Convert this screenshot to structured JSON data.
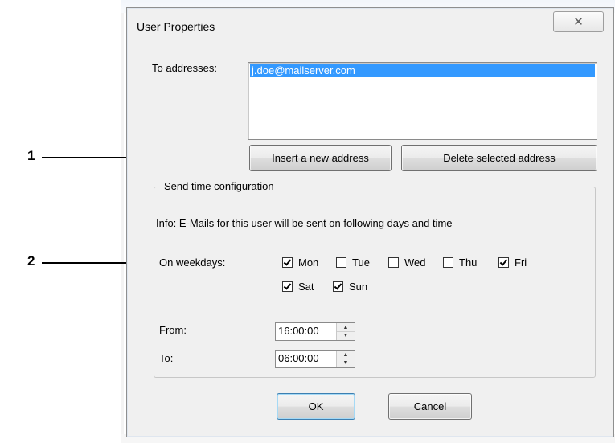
{
  "dialog": {
    "title": "User Properties",
    "close_glyph": "✕"
  },
  "addresses": {
    "label": "To addresses:",
    "items": [
      "j.doe@mailserver.com"
    ],
    "insert_button": "Insert a new address",
    "delete_button": "Delete selected address"
  },
  "send_time": {
    "group_title": "Send time configuration",
    "info": "Info: E-Mails for this user will be sent on following days and time",
    "weekdays_label": "On weekdays:",
    "days": [
      {
        "label": "Mon",
        "checked": true
      },
      {
        "label": "Tue",
        "checked": false
      },
      {
        "label": "Wed",
        "checked": false
      },
      {
        "label": "Thu",
        "checked": false
      },
      {
        "label": "Fri",
        "checked": true
      },
      {
        "label": "Sat",
        "checked": true
      },
      {
        "label": "Sun",
        "checked": true
      }
    ],
    "from_label": "From:",
    "from_value": "16:00:00",
    "to_label": "To:",
    "to_value": "06:00:00"
  },
  "footer": {
    "ok_button": "OK",
    "cancel_button": "Cancel"
  },
  "callouts": [
    "1",
    "2"
  ]
}
